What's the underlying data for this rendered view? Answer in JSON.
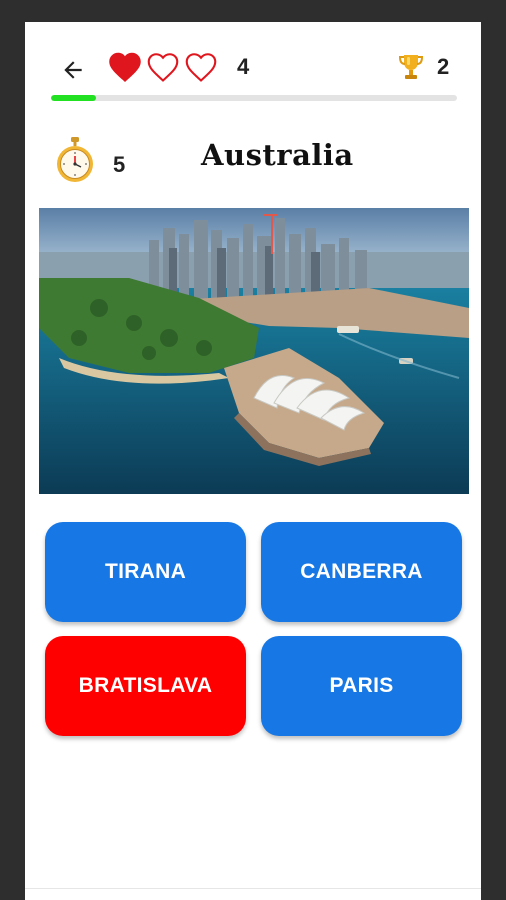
{
  "header": {
    "back_icon": "arrow-left-icon",
    "lives": [
      {
        "state": "full",
        "icon": "heart-filled-icon"
      },
      {
        "state": "empty",
        "icon": "heart-outline-icon"
      },
      {
        "state": "empty",
        "icon": "heart-outline-icon"
      }
    ],
    "score": "4",
    "trophy_icon": "trophy-icon",
    "trophy_count": "2",
    "progress_fraction": 0.11
  },
  "question": {
    "timer_icon": "stopwatch-icon",
    "timer_value": "5",
    "country": "Australia",
    "image_subject": "sydney-opera-house-aerial-photo"
  },
  "answers": [
    {
      "label": "TIRANA",
      "state": "default"
    },
    {
      "label": "CANBERRA",
      "state": "default"
    },
    {
      "label": "BRATISLAVA",
      "state": "wrong"
    },
    {
      "label": "PARIS",
      "state": "default"
    }
  ],
  "colors": {
    "heart": "#e0161e",
    "progress": "#22e022",
    "answer_default": "#1677e5",
    "answer_wrong": "#ff0000",
    "trophy": "#f2b01e",
    "stopwatch": "#f0b634"
  }
}
